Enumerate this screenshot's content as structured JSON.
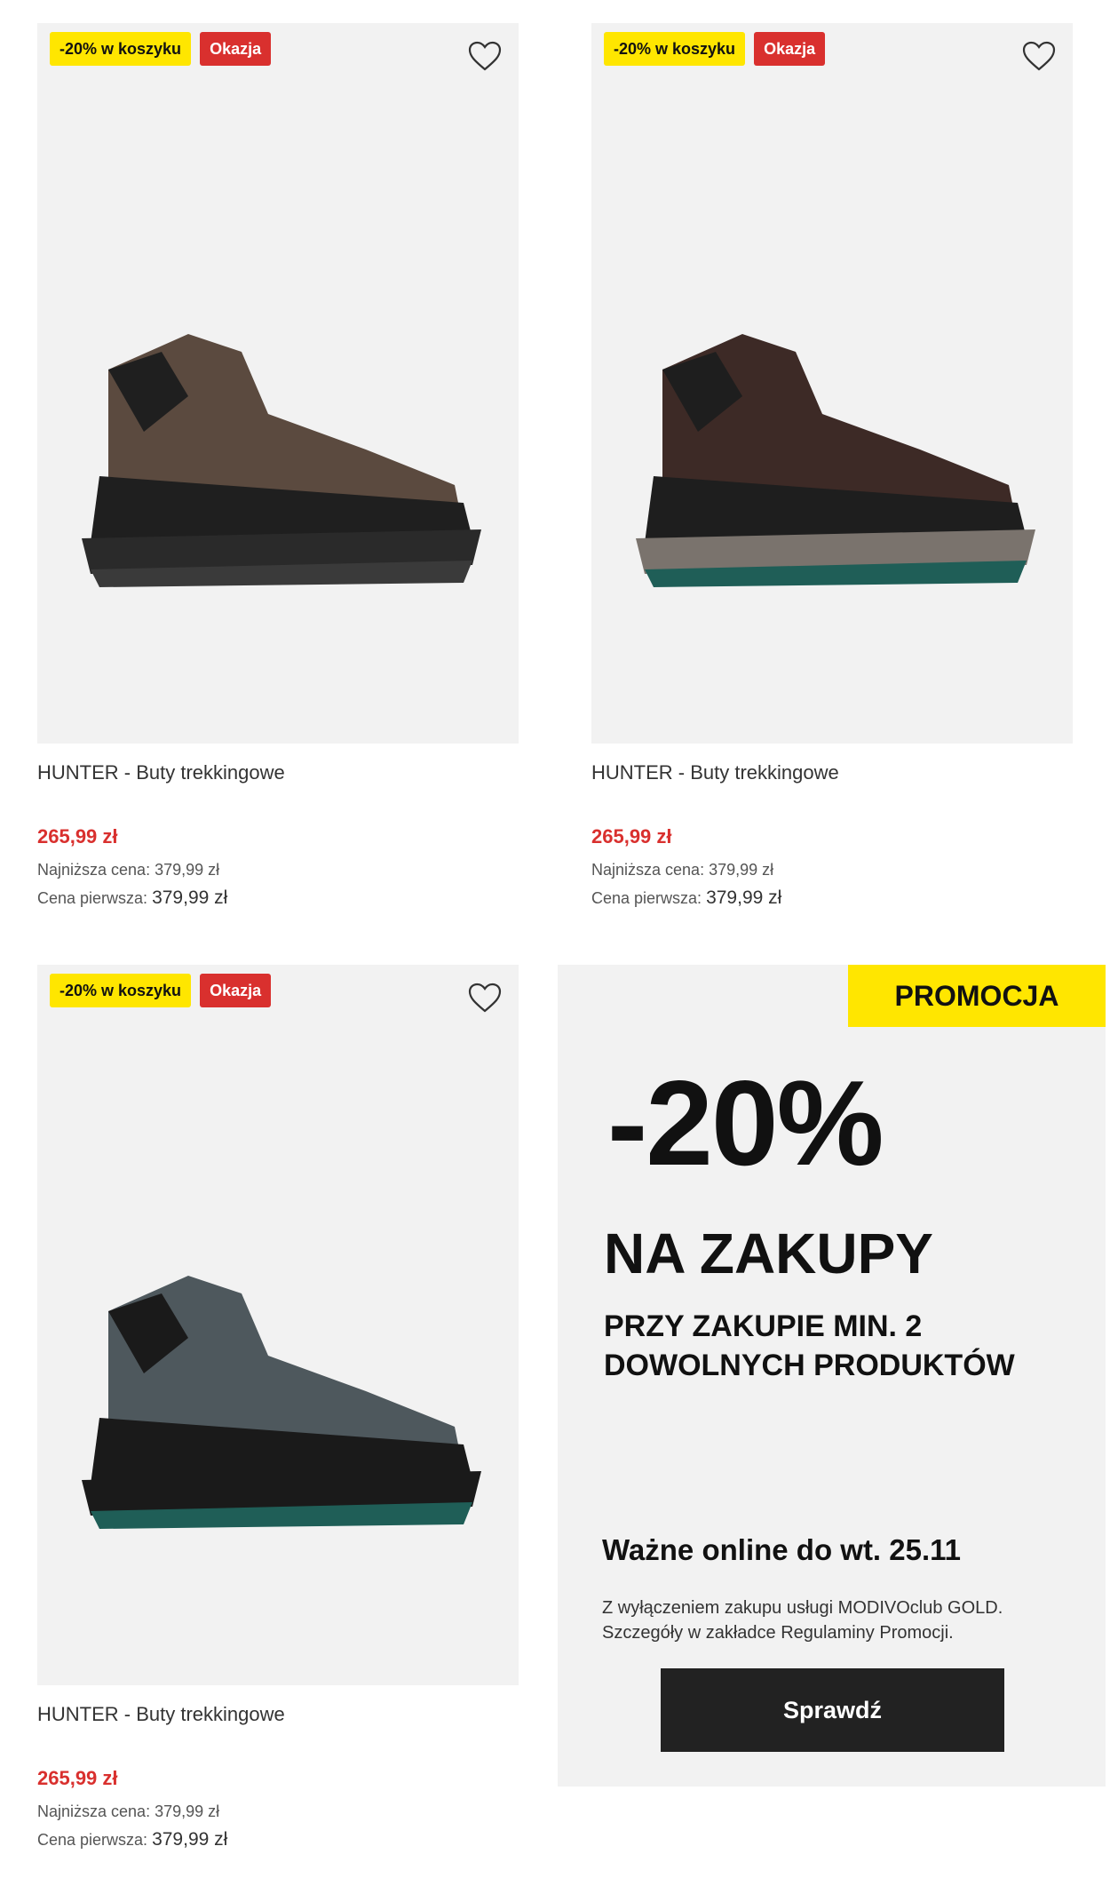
{
  "products": [
    {
      "badge_discount": "-20% w koszyku",
      "badge_deal": "Okazja",
      "name": "HUNTER - Buty trekkingowe",
      "price": "265,99 zł",
      "lowest_label": "Najniższa cena:",
      "lowest_value": "379,99 zł",
      "first_label": "Cena pierwsza:",
      "first_value": "379,99 zł",
      "colors": {
        "upper": "#5b4a3f",
        "base": "#1f1f1f",
        "sole": "#2a2a2a",
        "accent": "#3a3a3a"
      }
    },
    {
      "badge_discount": "-20% w koszyku",
      "badge_deal": "Okazja",
      "name": "HUNTER - Buty trekkingowe",
      "price": "265,99 zł",
      "lowest_label": "Najniższa cena:",
      "lowest_value": "379,99 zł",
      "first_label": "Cena pierwsza:",
      "first_value": "379,99 zł",
      "colors": {
        "upper": "#3d2a26",
        "base": "#1e1e1e",
        "sole": "#7a736d",
        "accent": "#1f5e57"
      }
    },
    {
      "badge_discount": "-20% w koszyku",
      "badge_deal": "Okazja",
      "name": "HUNTER - Buty trekkingowe",
      "price": "265,99 zł",
      "lowest_label": "Najniższa cena:",
      "lowest_value": "379,99 zł",
      "first_label": "Cena pierwsza:",
      "first_value": "379,99 zł",
      "colors": {
        "upper": "#4e585d",
        "base": "#1a1a1a",
        "sole": "#1a1a1a",
        "accent": "#1f5e57"
      }
    }
  ],
  "promo": {
    "tag": "PROMOCJA",
    "big": "-20%",
    "line1": "NA ZAKUPY",
    "line2": "PRZY ZAKUPIE MIN. 2 DOWOLNYCH PRODUKTÓW",
    "valid": "Ważne online do wt. 25.11",
    "fine": "Z wyłączeniem zakupu usługi MODIVOclub GOLD. Szczegóły w zakładce Regulaminy Promocji.",
    "button": "Sprawdź"
  },
  "icons": {
    "wishlist": "heart-outline-icon"
  },
  "theme": {
    "yellow": "#ffe600",
    "red": "#d9302e",
    "dark": "#222222"
  }
}
